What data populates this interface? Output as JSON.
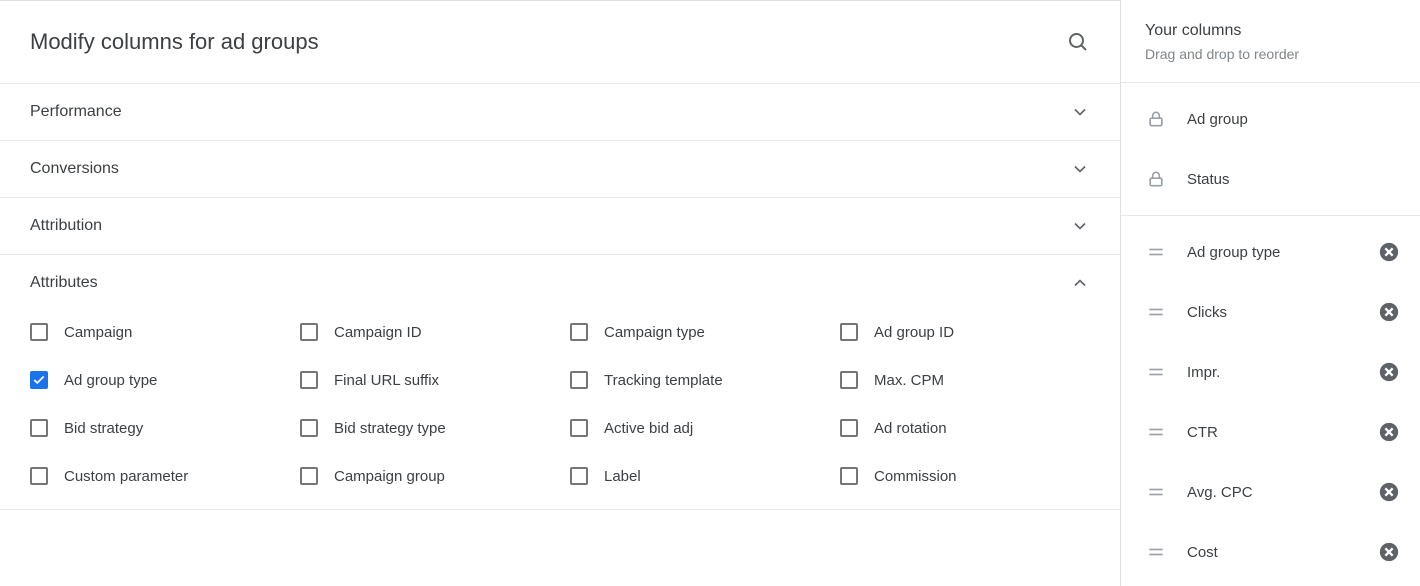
{
  "main": {
    "title": "Modify columns for ad groups",
    "sections": [
      {
        "id": "performance",
        "title": "Performance",
        "expanded": false
      },
      {
        "id": "conversions",
        "title": "Conversions",
        "expanded": false
      },
      {
        "id": "attribution",
        "title": "Attribution",
        "expanded": false
      },
      {
        "id": "attributes",
        "title": "Attributes",
        "expanded": true,
        "items": [
          {
            "label": "Campaign",
            "checked": false
          },
          {
            "label": "Campaign ID",
            "checked": false
          },
          {
            "label": "Campaign type",
            "checked": false
          },
          {
            "label": "Ad group ID",
            "checked": false
          },
          {
            "label": "Ad group type",
            "checked": true
          },
          {
            "label": "Final URL suffix",
            "checked": false
          },
          {
            "label": "Tracking template",
            "checked": false
          },
          {
            "label": "Max. CPM",
            "checked": false
          },
          {
            "label": "Bid strategy",
            "checked": false
          },
          {
            "label": "Bid strategy type",
            "checked": false
          },
          {
            "label": "Active bid adj",
            "checked": false
          },
          {
            "label": "Ad rotation",
            "checked": false
          },
          {
            "label": "Custom parameter",
            "checked": false
          },
          {
            "label": "Campaign group",
            "checked": false
          },
          {
            "label": "Label",
            "checked": false
          },
          {
            "label": "Commission",
            "checked": false
          }
        ]
      }
    ]
  },
  "side": {
    "title": "Your columns",
    "subtitle": "Drag and drop to reorder",
    "locked": [
      {
        "label": "Ad group"
      },
      {
        "label": "Status"
      }
    ],
    "draggable": [
      {
        "label": "Ad group type"
      },
      {
        "label": "Clicks"
      },
      {
        "label": "Impr."
      },
      {
        "label": "CTR"
      },
      {
        "label": "Avg. CPC"
      },
      {
        "label": "Cost"
      }
    ]
  }
}
